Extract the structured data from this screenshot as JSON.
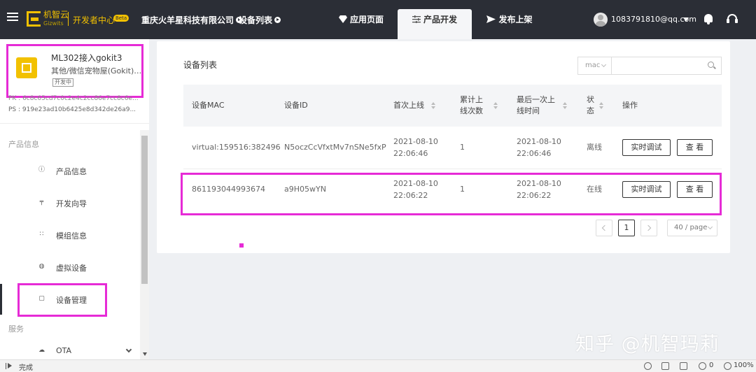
{
  "topnav": {
    "logo_text": "机智云",
    "logo_sub": "Gizwits",
    "dev_center": "开发者中心",
    "beta": "Beta",
    "company": "重庆火羊星科技有限公司",
    "device_list": "设备列表",
    "tabs": [
      {
        "label": "应用页面",
        "icon": "diamond-icon"
      },
      {
        "label": "产品开发",
        "icon": "sliders-icon",
        "active": true
      },
      {
        "label": "发布上架",
        "icon": "send-icon"
      }
    ],
    "user_email": "1083791810@qq.com"
  },
  "sidebar": {
    "product_name": "ML302接入gokit3",
    "product_category": "其他/微信宠物屋(Gokit)/...",
    "product_status": "开发中",
    "pk_line": "PK : 6c8c65cd7c0c2e4c2cc86e7cc8c6e...",
    "ps_line": "PS : 919e23ad10b6425e8d342de26a9...",
    "sections": [
      "产品信息",
      "服务"
    ],
    "items": [
      {
        "label": "产品信息",
        "icon": "info-icon"
      },
      {
        "label": "开发向导",
        "icon": "pin-icon"
      },
      {
        "label": "模组信息",
        "icon": "grid-icon"
      },
      {
        "label": "虚拟设备",
        "icon": "virtual-icon"
      },
      {
        "label": "设备管理",
        "icon": "device-icon",
        "active": true
      },
      {
        "label": "OTA",
        "icon": "cloud-icon"
      }
    ]
  },
  "main": {
    "title": "设备列表",
    "search_select": "mac",
    "columns": [
      "设备MAC",
      "设备ID",
      "首次上线",
      "累计上线次数",
      "最后一次上线时间",
      "状态",
      "操作"
    ],
    "rows": [
      {
        "mac": "virtual:159516:382496",
        "id": "N5oczCcVfxtMv7nSNe5fxP",
        "first_date": "2021-08-10",
        "first_time": "22:06:46",
        "count": "1",
        "last_date": "2021-08-10",
        "last_time": "22:06:46",
        "status": "离线",
        "debug": "实时调试",
        "view": "查 看"
      },
      {
        "mac": "861193044993674",
        "id": "a9H05wYN",
        "first_date": "2021-08-10",
        "first_time": "22:06:22",
        "count": "1",
        "last_date": "2021-08-10",
        "last_time": "22:06:22",
        "status": "在线",
        "debug": "实时调试",
        "view": "查 看"
      }
    ],
    "pager": {
      "current": "1",
      "page_size": "40 / page"
    }
  },
  "watermark": "知乎 @机智玛莉",
  "statusbar": {
    "status": "完成",
    "count": "0",
    "zoom": "100%"
  },
  "colors": {
    "nav_bg": "#2b2e36",
    "brand": "#f2c100",
    "highlight": "#e62bd6"
  }
}
